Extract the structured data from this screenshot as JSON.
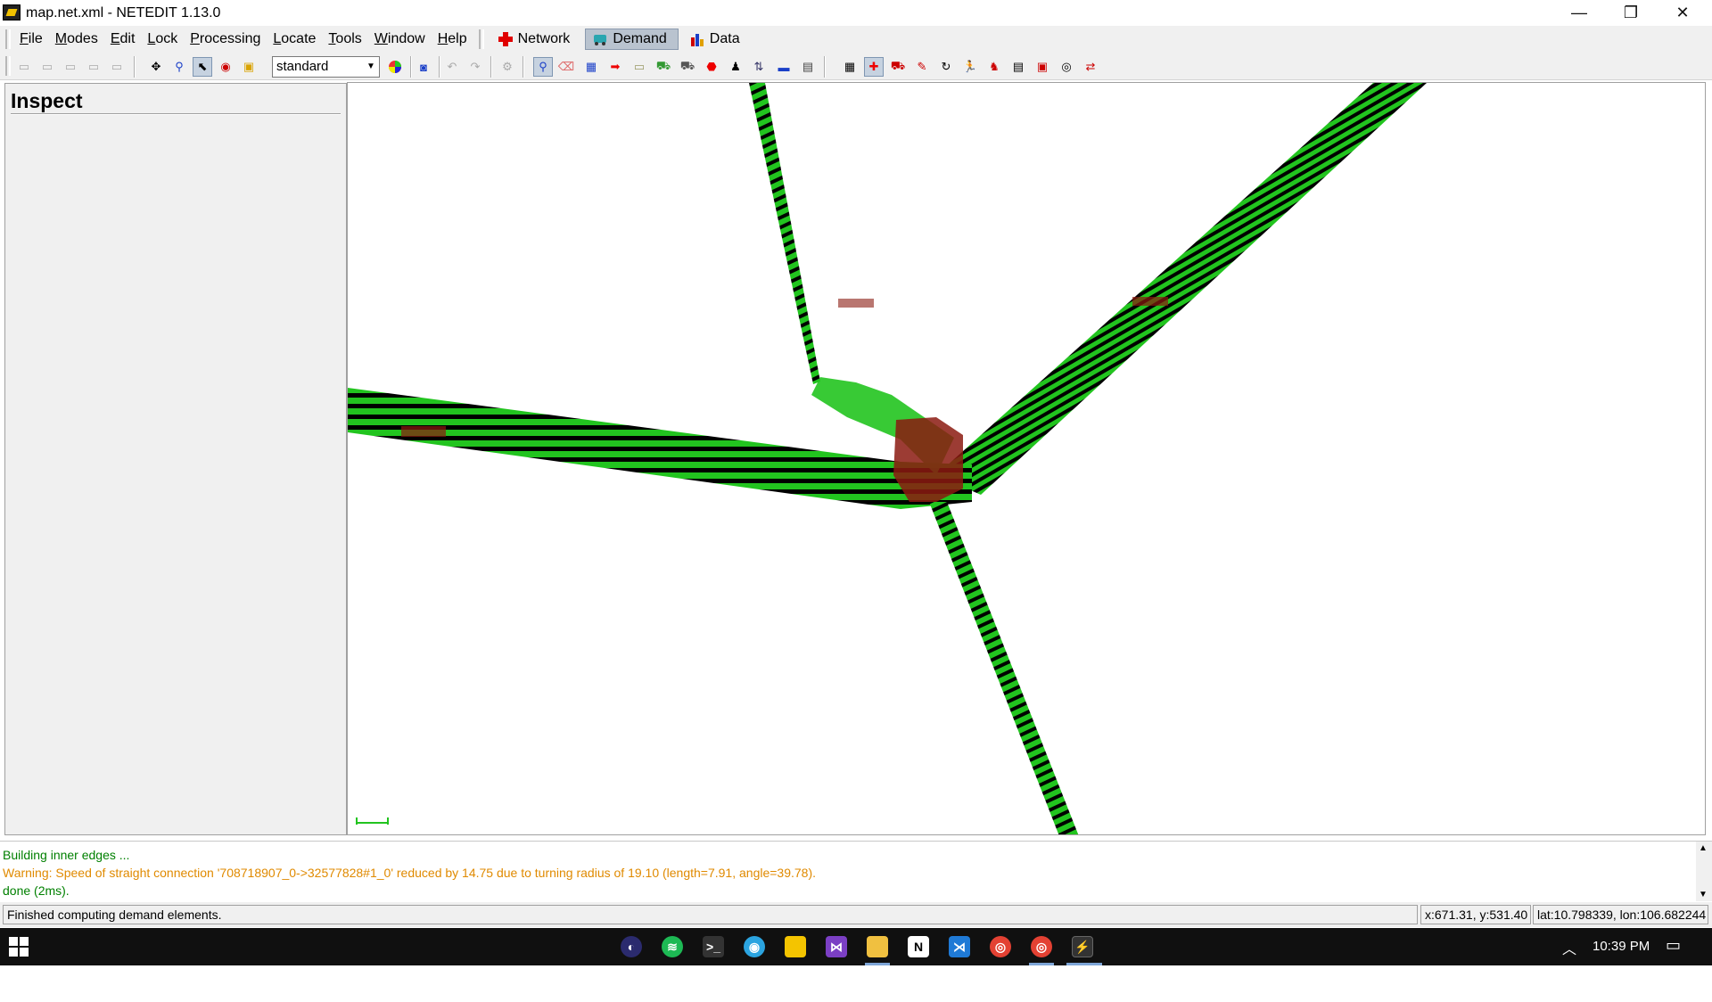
{
  "window": {
    "title": "map.net.xml - NETEDIT 1.13.0",
    "minimize": "—",
    "restore": "❐",
    "close": "✕"
  },
  "menubar": {
    "items": [
      "File",
      "Modes",
      "Edit",
      "Lock",
      "Processing",
      "Locate",
      "Tools",
      "Window",
      "Help"
    ],
    "access_keys": [
      "F",
      "M",
      "E",
      "L",
      "P",
      "L",
      "T",
      "W",
      "H"
    ]
  },
  "supermodes": {
    "network": "Network",
    "demand": "Demand",
    "data": "Data",
    "active": "Demand"
  },
  "toolbar": {
    "color_scheme": "standard"
  },
  "left_panel": {
    "title": "Inspect"
  },
  "messages": {
    "lines": [
      {
        "text": "Building inner edges ...",
        "color": "#008000"
      },
      {
        "text": "Warning: Speed of straight connection '708718907_0->32577828#1_0' reduced by 14.75 due to turning radius of 19.10 (length=7.91, angle=39.78).",
        "color": "#e08a00"
      },
      {
        "text": "done (2ms).",
        "color": "#008000"
      }
    ]
  },
  "statusbar": {
    "status": "Finished computing demand elements.",
    "xy": "x:671.31, y:531.40",
    "latlon": "lat:10.798339, lon:106.682244"
  },
  "taskbar": {
    "clock": "10:39 PM"
  },
  "colors": {
    "lane_green": "#22c41f",
    "lane_black": "#000000",
    "junction_red": "#8b1a10",
    "warning": "#e08a00",
    "ok": "#008000",
    "active_mode_bg": "#b9c3cf"
  }
}
